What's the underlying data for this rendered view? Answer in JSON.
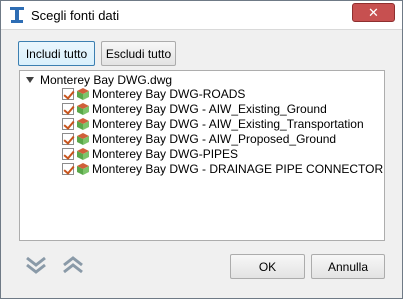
{
  "window": {
    "title": "Scegli fonti dati",
    "close_label": "✕"
  },
  "toolbar": {
    "include_all": "Includi tutto",
    "exclude_all": "Escludi tutto"
  },
  "tree": {
    "root_label": "Monterey Bay DWG.dwg",
    "items": [
      {
        "label": "Monterey Bay DWG-ROADS",
        "checked": true
      },
      {
        "label": "Monterey Bay DWG - AIW_Existing_Ground",
        "checked": true
      },
      {
        "label": "Monterey Bay DWG - AIW_Existing_Transportation",
        "checked": true
      },
      {
        "label": "Monterey Bay DWG - AIW_Proposed_Ground",
        "checked": true
      },
      {
        "label": "Monterey Bay DWG-PIPES",
        "checked": true
      },
      {
        "label": "Monterey Bay DWG - DRAINAGE PIPE CONNECTOR",
        "checked": true
      }
    ]
  },
  "footer": {
    "ok_label": "OK",
    "cancel_label": "Annulla",
    "expand_icon": "double-chevron-down-icon",
    "collapse_icon": "double-chevron-up-icon"
  },
  "colors": {
    "close_button": "#c75050",
    "checkmark": "#c8541c",
    "layer_icon_green": "#5aa84a",
    "layer_icon_red": "#d0603a"
  }
}
